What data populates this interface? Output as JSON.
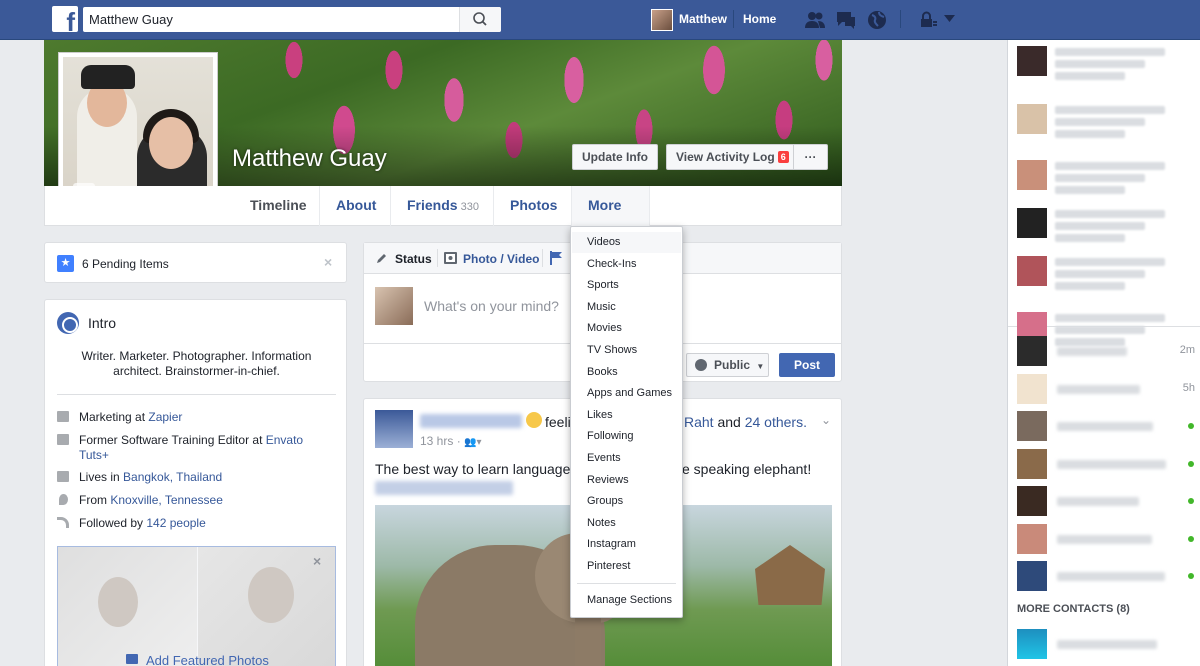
{
  "topbar": {
    "logo": "f",
    "search_value": "Matthew Guay",
    "user_name": "Matthew",
    "home_label": "Home",
    "icons": [
      "friend-requests-icon",
      "messages-icon",
      "notifications-globe-icon",
      "privacy-lock-icon",
      "account-menu-caret-icon"
    ]
  },
  "profile": {
    "name": "Matthew Guay",
    "update_info_label": "Update Info",
    "activity_log_label": "View Activity Log",
    "activity_log_badge": "6",
    "more_options_label": "···"
  },
  "profile_nav": {
    "timeline": "Timeline",
    "about": "About",
    "friends": "Friends",
    "friends_count": "330",
    "photos": "Photos",
    "more": "More"
  },
  "more_menu": {
    "items": [
      "Videos",
      "Check-Ins",
      "Sports",
      "Music",
      "Movies",
      "TV Shows",
      "Books",
      "Apps and Games",
      "Likes",
      "Following",
      "Events",
      "Reviews",
      "Groups",
      "Notes",
      "Instagram",
      "Pinterest"
    ],
    "manage_label": "Manage Sections"
  },
  "pending": {
    "text": "6 Pending Items"
  },
  "intro": {
    "title": "Intro",
    "bio": "Writer. Marketer. Photographer. Information architect. Brainstormer-in-chief.",
    "work1_prefix": "Marketing at ",
    "work1_link": "Zapier",
    "work2_prefix": "Former Software Training Editor at ",
    "work2_link": "Envato Tuts+",
    "lives_prefix": "Lives in ",
    "lives_link": "Bangkok, Thailand",
    "from_prefix": "From ",
    "from_link": "Knoxville, Tennessee",
    "followed_prefix": "Followed by ",
    "followed_link": "142 people",
    "add_featured_label": "Add Featured Photos"
  },
  "composer": {
    "tab_status": "Status",
    "tab_photo": "Photo / Video",
    "placeholder": "What's on your mind?",
    "privacy_label": "Public",
    "post_label": "Post"
  },
  "post": {
    "feeling_text": "feelin",
    "tagged_name": "Raht",
    "tagged_and": "and",
    "tagged_others": "24 others.",
    "time": "13 hrs",
    "body_left": "The best way to learn language is",
    "body_right": "e speaking elephant!"
  },
  "chat": {
    "contact_times": [
      "2m",
      "5h"
    ],
    "more_contacts_label": "MORE CONTACTS (8)"
  }
}
